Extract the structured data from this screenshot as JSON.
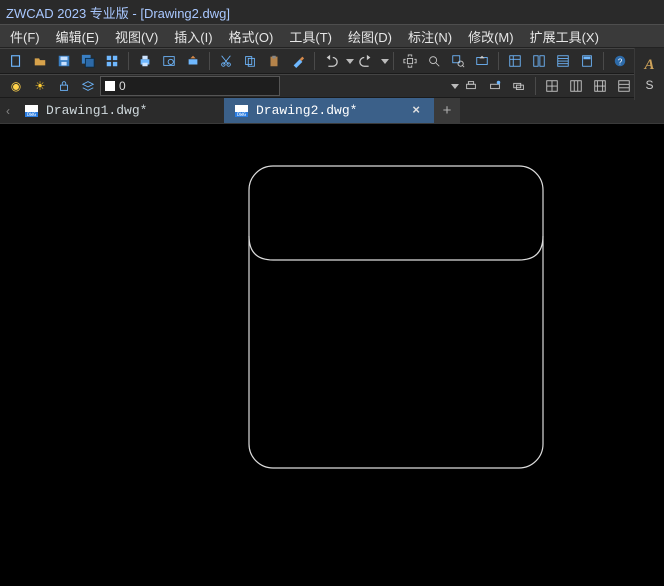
{
  "title": "ZWCAD 2023 专业版 - [Drawing2.dwg]",
  "menus": {
    "file": "件(F)",
    "edit": "编辑(E)",
    "view": "视图(V)",
    "insert": "插入(I)",
    "format": "格式(O)",
    "tools": "工具(T)",
    "draw": "绘图(D)",
    "dimension": "标注(N)",
    "modify": "修改(M)",
    "extension_tools": "扩展工具(X)"
  },
  "layer": {
    "name": "0"
  },
  "tabs": [
    {
      "label": "Drawing1.dwg*",
      "active": false
    },
    {
      "label": "Drawing2.dwg*",
      "active": true
    }
  ],
  "add_tab_glyph": "+",
  "right_label": "S",
  "close_glyph": "×",
  "icons": {
    "bulb": "lightbulb",
    "sun": "sun",
    "lock": "lock",
    "layer": "layer",
    "tri": "dropdown",
    "print": "printer",
    "help": "help",
    "undo": "undo",
    "redo": "redo"
  }
}
